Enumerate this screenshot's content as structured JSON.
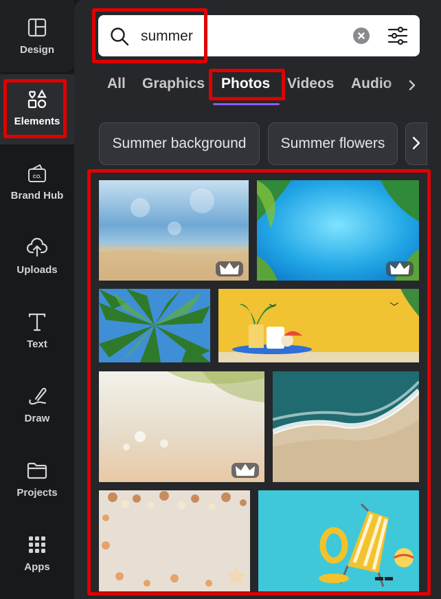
{
  "sidebar": {
    "items": [
      {
        "label": "Design",
        "icon": "layout-icon"
      },
      {
        "label": "Elements",
        "icon": "shapes-icon"
      },
      {
        "label": "Brand Hub",
        "icon": "brand-icon"
      },
      {
        "label": "Uploads",
        "icon": "cloud-upload-icon"
      },
      {
        "label": "Text",
        "icon": "text-icon"
      },
      {
        "label": "Draw",
        "icon": "draw-icon"
      },
      {
        "label": "Projects",
        "icon": "folder-icon"
      },
      {
        "label": "Apps",
        "icon": "apps-grid-icon"
      }
    ]
  },
  "search": {
    "value": "summer"
  },
  "tabs": [
    "All",
    "Graphics",
    "Photos",
    "Videos",
    "Audio"
  ],
  "active_tab": "Photos",
  "chips": [
    "Summer background",
    "Summer flowers"
  ],
  "photos": [
    {
      "subject": "beach sand with blurred sea",
      "premium": true
    },
    {
      "subject": "tropical pool water with palm leaves",
      "premium": true
    },
    {
      "subject": "palm trees from below",
      "premium": false
    },
    {
      "subject": "beach suitcase scene on yellow",
      "premium": false
    },
    {
      "subject": "blurred beach with palm",
      "premium": true
    },
    {
      "subject": "aerial ocean waves on sand",
      "premium": false
    },
    {
      "subject": "seashells on sand",
      "premium": false
    },
    {
      "subject": "beach chair on blue",
      "premium": false
    }
  ],
  "colors": {
    "accent": "#8b5cf6",
    "highlight": "#e00000",
    "panel": "#26272b",
    "sidebar": "#18191b"
  }
}
